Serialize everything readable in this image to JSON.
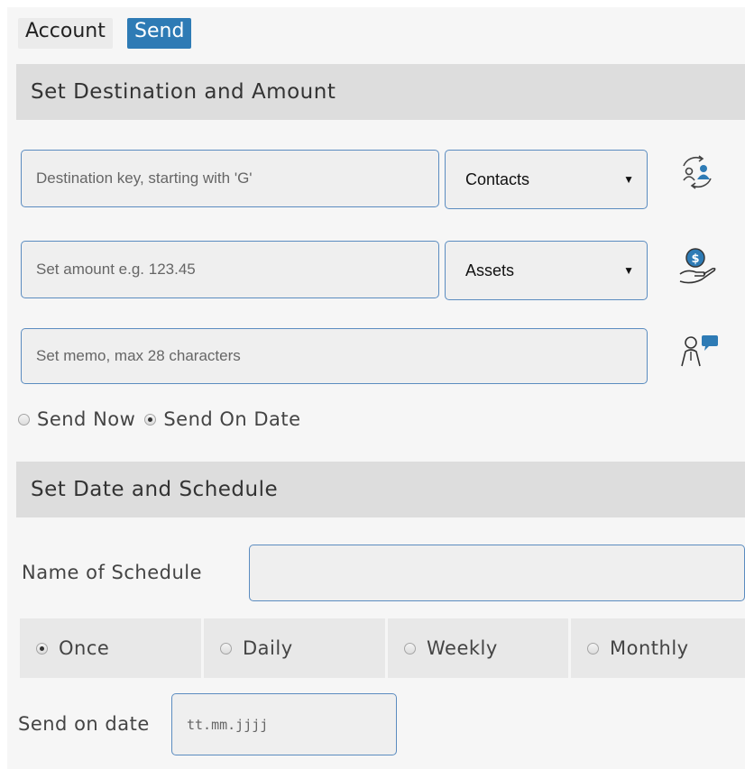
{
  "tabs": {
    "account": "Account",
    "send": "Send"
  },
  "sections": {
    "destination": "Set Destination and Amount",
    "schedule": "Set Date and Schedule"
  },
  "destination": {
    "placeholder": "Destination key, starting with 'G'",
    "select_value": "Contacts",
    "icon": "contacts-sync-icon"
  },
  "amount": {
    "placeholder": "Set amount e.g. 123.45",
    "select_value": "Assets",
    "icon": "money-hand-icon"
  },
  "memo": {
    "placeholder": "Set memo, max 28 characters",
    "icon": "person-chat-icon"
  },
  "send_mode": {
    "now": "Send Now",
    "on_date": "Send On Date",
    "selected": "on_date"
  },
  "schedule": {
    "name_label": "Name of Schedule",
    "name_value": "",
    "frequency": [
      "Once",
      "Daily",
      "Weekly",
      "Monthly"
    ],
    "selected_frequency": "Once",
    "date_label": "Send on date",
    "date_placeholder": "tt.mm.jjjj"
  },
  "colors": {
    "accent": "#2e7bb5",
    "input_border": "#5b8cc0",
    "section_bg": "#dddddd"
  }
}
